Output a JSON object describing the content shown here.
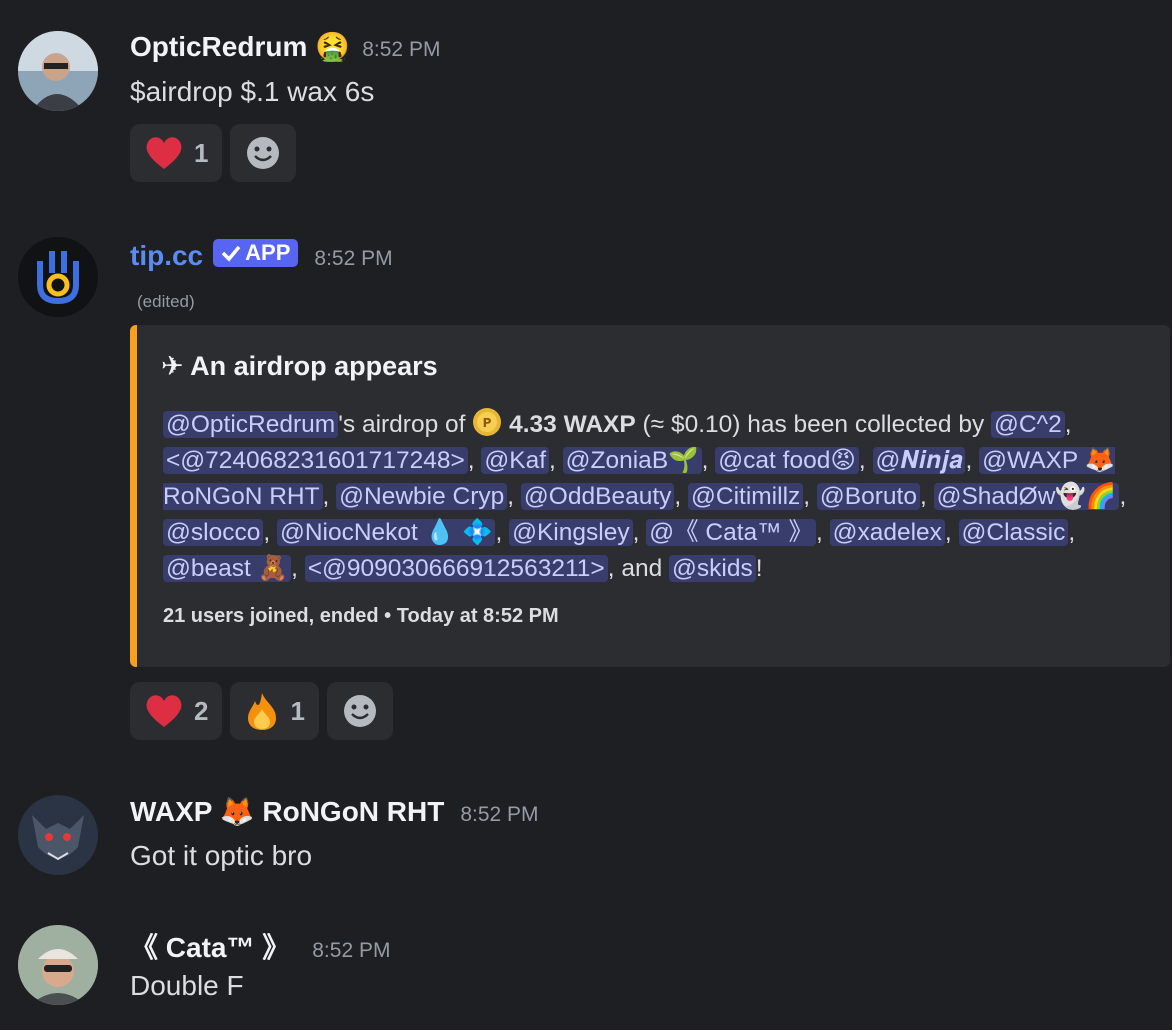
{
  "messages": [
    {
      "username": "OpticRedrum",
      "user_emoji": "🤮",
      "time": "8:52 PM",
      "text": "$airdrop $.1 wax 6s",
      "reactions": [
        {
          "emoji": "❤️",
          "count": "1"
        }
      ]
    },
    {
      "username": "tip.cc",
      "badge": "APP",
      "time": "8:52 PM",
      "edited": "(edited)",
      "embed": {
        "title": "✈ An airdrop appears",
        "author_mention": "@OpticRedrum",
        "airdrop_prefix": "'s airdrop of",
        "amount": "4.33 WAXP",
        "usd": "(≈ $0.10) has been collected by",
        "mentions": [
          "@C^2",
          "<@724068231601717248>",
          "@Kaf",
          "@ZoniaB🌱",
          "@cat food😡",
          "@𝑵𝒊𝒏𝒋𝒂",
          "@WAXP 🦊 RoNGoN RHT",
          "@Newbie Cryp",
          "@OddBeauty",
          "@Citimillz",
          "@Boruto",
          "@ShadØw👻🌈",
          "@slocco",
          "@NiocNekot 💧 💠",
          "@Kingsley",
          "@《 Cata™ 》",
          "@xadelex",
          "@Classic",
          "@beast 🧸",
          "<@909030666912563211>"
        ],
        "and_text": "and",
        "last_mention": "@skids",
        "end_text": "!",
        "footer": "21 users joined, ended • Today at 8:52 PM"
      },
      "reactions": [
        {
          "emoji": "❤️",
          "count": "2"
        },
        {
          "emoji": "🔥",
          "count": "1"
        }
      ]
    },
    {
      "username": "WAXP 🦊 RoNGoN RHT",
      "time": "8:52 PM",
      "text": "Got it optic bro"
    },
    {
      "username": "《 Cata™ 》",
      "time": "8:52 PM",
      "text": "Double F"
    }
  ]
}
